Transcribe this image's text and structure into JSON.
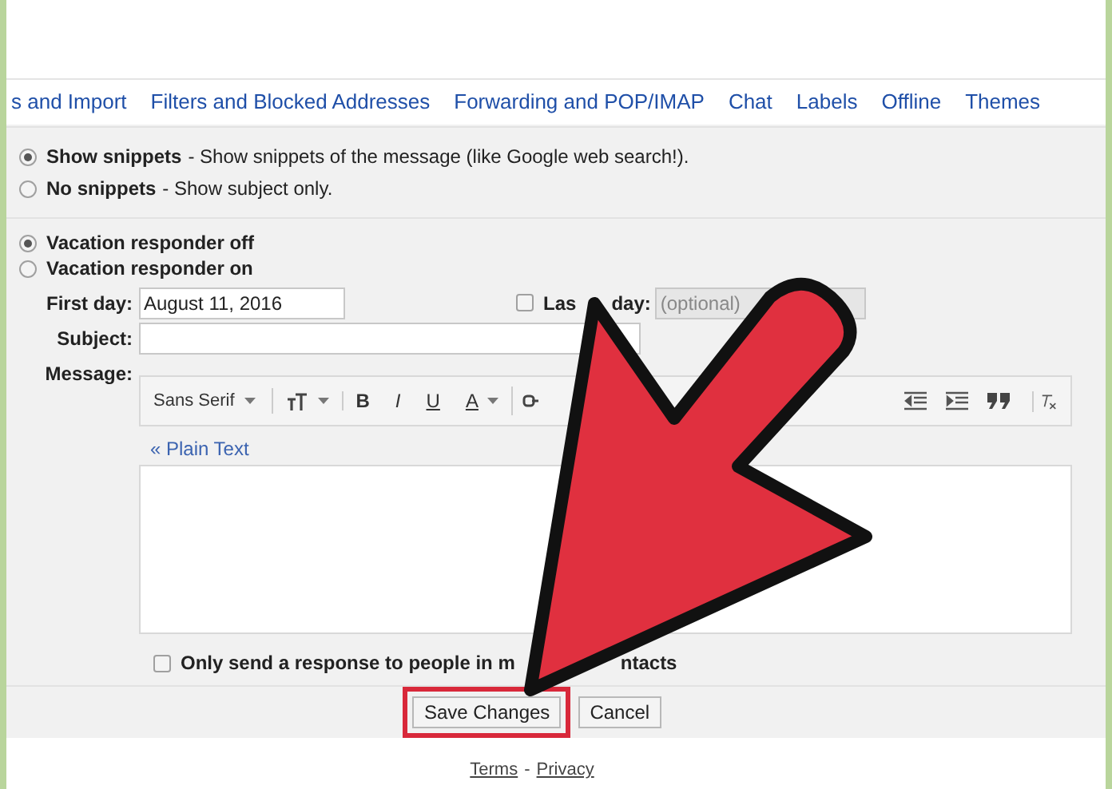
{
  "tabs": [
    {
      "label": "s and Import",
      "selected": false
    },
    {
      "label": "Filters and Blocked Addresses",
      "selected": false
    },
    {
      "label": "Forwarding and POP/IMAP",
      "selected": false
    },
    {
      "label": "Chat",
      "selected": false
    },
    {
      "label": "Labels",
      "selected": false
    },
    {
      "label": "Offline",
      "selected": false
    },
    {
      "label": "Themes",
      "selected": false
    }
  ],
  "snippets": [
    {
      "label": "Show snippets",
      "description": "- Show snippets of the message (like Google web search!).",
      "selected": true
    },
    {
      "label": "No snippets",
      "description": "- Show subject only.",
      "selected": false
    }
  ],
  "vacation": {
    "options": [
      {
        "label": "Vacation responder off",
        "selected": true
      },
      {
        "label": "Vacation responder on",
        "selected": false
      }
    ],
    "first_day_label": "First day:",
    "first_day": "August 11, 2016",
    "last_day": {
      "checked": false,
      "label_parts": [
        "Las",
        "day:"
      ],
      "placeholder": "(optional)"
    },
    "subject_label": "Subject:",
    "message_label": "Message:",
    "toolbar": {
      "font": "Sans Serif",
      "bold": "B",
      "italic": "I",
      "underline": "U",
      "font_color": "A"
    },
    "plain_text_link": "« Plain Text",
    "only_contacts": {
      "checked": false,
      "label_parts": [
        "Only send a response to people in m",
        "ntacts"
      ]
    }
  },
  "buttons": {
    "save": "Save Changes",
    "cancel": "Cancel"
  },
  "footer": {
    "links": [
      "Terms",
      "Privacy"
    ],
    "separator": "-"
  }
}
